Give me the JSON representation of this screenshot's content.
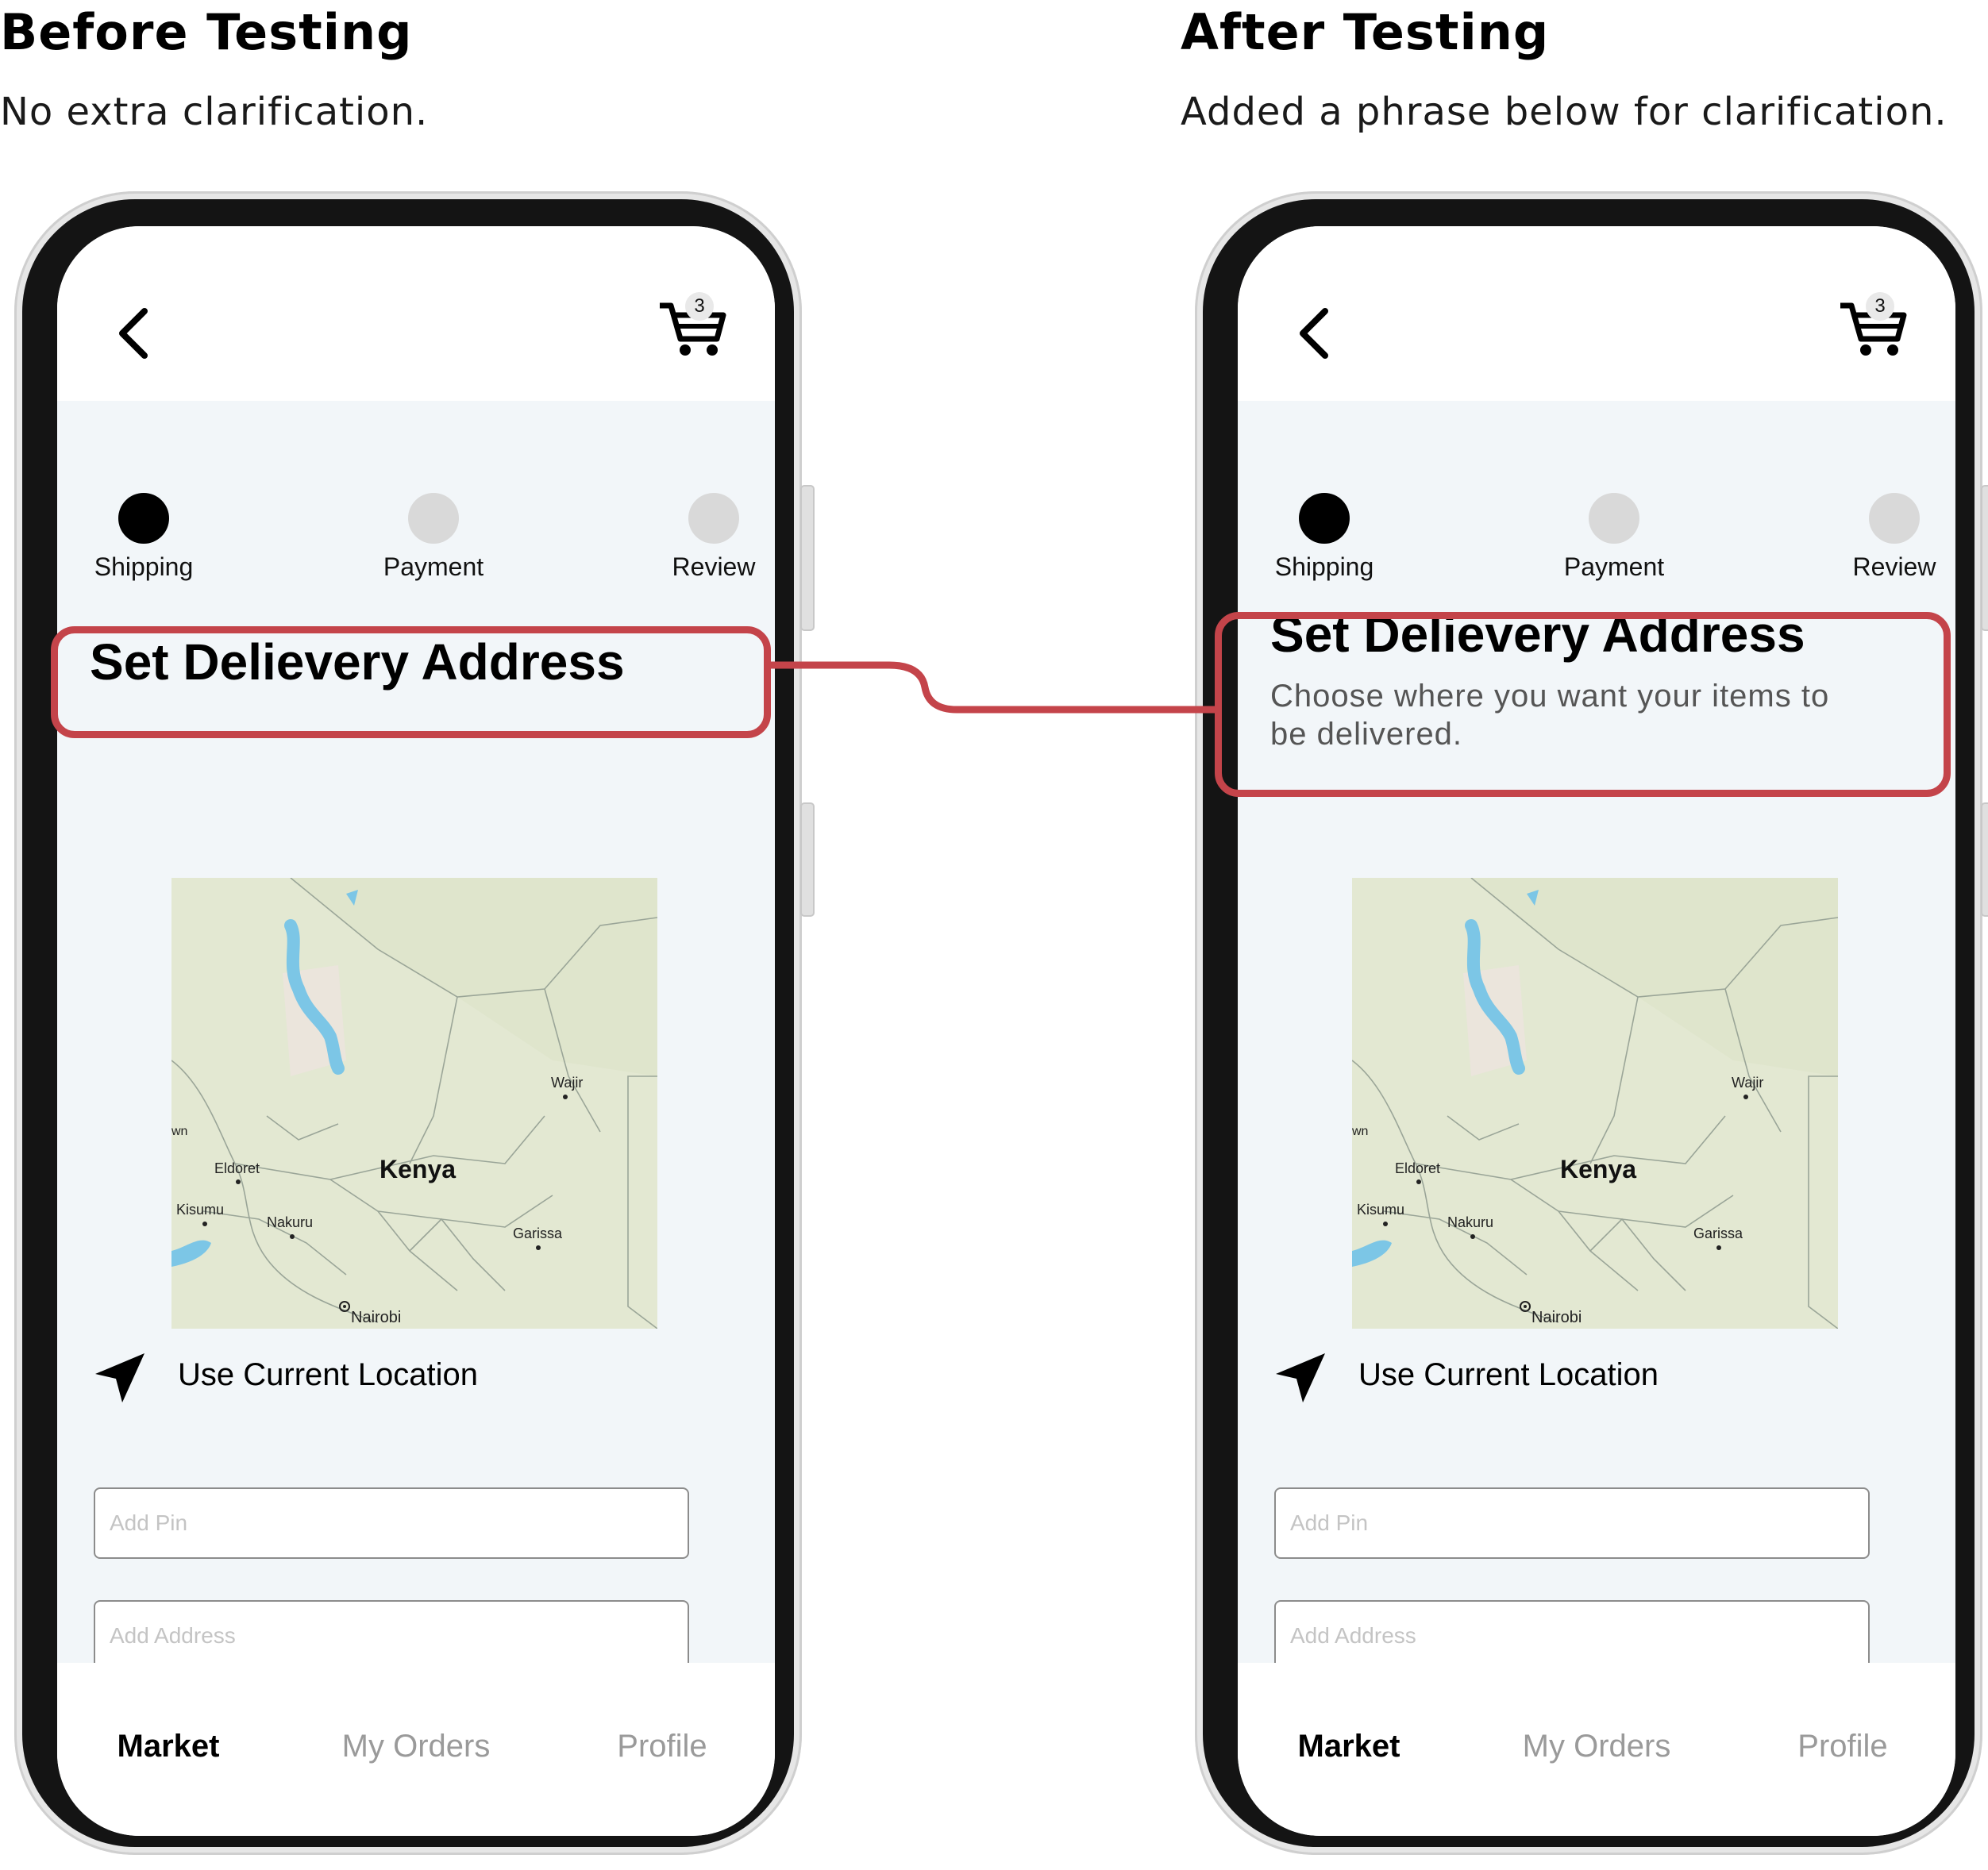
{
  "panels": [
    {
      "title": "Before Testing",
      "description": "No extra clarification.",
      "screen": {
        "cart_count": "3",
        "steps": [
          "Shipping",
          "Payment",
          "Review"
        ],
        "section_title": "Set Delievery Address",
        "section_subtitle": "",
        "map_labels": {
          "country": "Kenya",
          "cities": [
            "Wajir",
            "Eldoret",
            "Kisumu",
            "Nakuru",
            "Garissa",
            "Nairobi"
          ],
          "edge": "wn"
        },
        "location_label": "Use Current Location",
        "pin_placeholder": "Add Pin",
        "address_placeholder": "Add Address",
        "nav": [
          "Market",
          "My Orders",
          "Profile"
        ]
      }
    },
    {
      "title": "After Testing",
      "description": "Added a phrase below for clarification.",
      "screen": {
        "cart_count": "3",
        "steps": [
          "Shipping",
          "Payment",
          "Review"
        ],
        "section_title": "Set Delievery Address",
        "section_subtitle": "Choose where you want your items to be delivered.",
        "map_labels": {
          "country": "Kenya",
          "cities": [
            "Wajir",
            "Eldoret",
            "Kisumu",
            "Nakuru",
            "Garissa",
            "Nairobi"
          ],
          "edge": "wn"
        },
        "location_label": "Use Current Location",
        "pin_placeholder": "Add Pin",
        "address_placeholder": "Add Address",
        "nav": [
          "Market",
          "My Orders",
          "Profile"
        ]
      }
    }
  ],
  "colors": {
    "highlight": "#c4444a",
    "active_step": "#000000",
    "inactive_step": "#d9d9d9",
    "screen_bg": "#f2f6f9"
  }
}
